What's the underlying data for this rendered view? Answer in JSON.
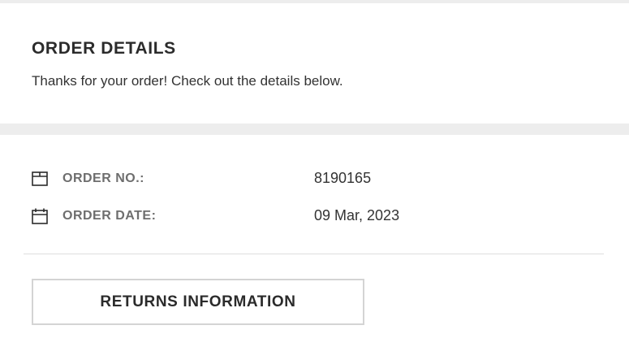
{
  "header": {
    "title": "ORDER DETAILS",
    "subtitle": "Thanks for your order! Check out the details below."
  },
  "details": [
    {
      "icon": "box-icon",
      "label": "ORDER NO.:",
      "value": "8190165"
    },
    {
      "icon": "calendar-icon",
      "label": "ORDER DATE:",
      "value": "09 Mar, 2023"
    }
  ],
  "actions": {
    "returns_label": "RETURNS INFORMATION"
  },
  "colors": {
    "background": "#ededed",
    "card": "#ffffff",
    "text": "#2b2b2b",
    "label": "#6e6e6e",
    "border": "#d4d4d4"
  }
}
